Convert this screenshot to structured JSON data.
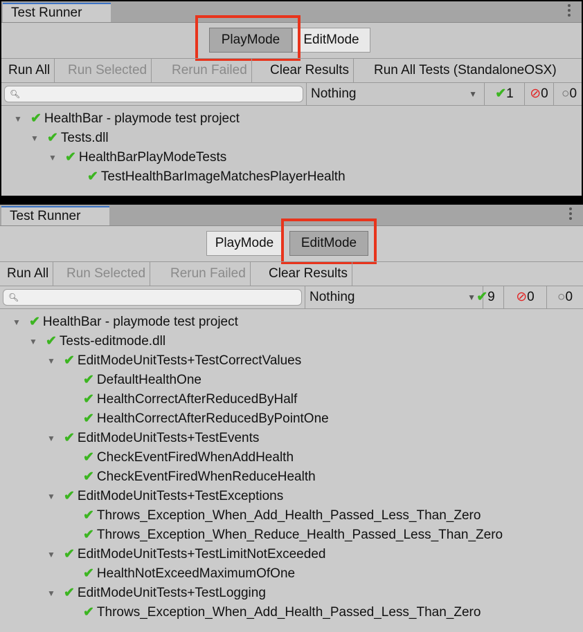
{
  "top": {
    "tab_title": "Test Runner",
    "mode_buttons": {
      "playmode": "PlayMode",
      "editmode": "EditMode",
      "selected": "PlayMode"
    },
    "toolbar": {
      "run_all": "Run All",
      "run_selected": "Run Selected",
      "rerun_failed": "Rerun Failed",
      "clear_results": "Clear Results",
      "run_all_tests_platform": "Run All Tests (StandaloneOSX)"
    },
    "filter": {
      "search_value": "",
      "category": "Nothing",
      "passed": "1",
      "failed": "0",
      "not_run": "0"
    },
    "tree": [
      {
        "label": "HealthBar - playmode test project"
      },
      {
        "label": "Tests.dll"
      },
      {
        "label": "HealthBarPlayModeTests"
      },
      {
        "label": "TestHealthBarImageMatchesPlayerHealth"
      }
    ]
  },
  "bottom": {
    "tab_title": "Test Runner",
    "mode_buttons": {
      "playmode": "PlayMode",
      "editmode": "EditMode",
      "selected": "EditMode"
    },
    "toolbar": {
      "run_all": "Run All",
      "run_selected": "Run Selected",
      "rerun_failed": "Rerun Failed",
      "clear_results": "Clear Results"
    },
    "filter": {
      "search_value": "",
      "category": "Nothing",
      "passed": "9",
      "failed": "0",
      "not_run": "0"
    },
    "tree": [
      {
        "label": "HealthBar - playmode test project"
      },
      {
        "label": "Tests-editmode.dll"
      },
      {
        "label": "EditModeUnitTests+TestCorrectValues"
      },
      {
        "label": "DefaultHealthOne"
      },
      {
        "label": "HealthCorrectAfterReducedByHalf"
      },
      {
        "label": "HealthCorrectAfterReducedByPointOne"
      },
      {
        "label": "EditModeUnitTests+TestEvents"
      },
      {
        "label": "CheckEventFiredWhenAddHealth"
      },
      {
        "label": "CheckEventFiredWhenReduceHealth"
      },
      {
        "label": "EditModeUnitTests+TestExceptions"
      },
      {
        "label": "Throws_Exception_When_Add_Health_Passed_Less_Than_Zero"
      },
      {
        "label": "Throws_Exception_When_Reduce_Health_Passed_Less_Than_Zero"
      },
      {
        "label": "EditModeUnitTests+TestLimitNotExceeded"
      },
      {
        "label": "HealthNotExceedMaximumOfOne"
      },
      {
        "label": "EditModeUnitTests+TestLogging"
      },
      {
        "label": "Throws_Exception_When_Add_Health_Passed_Less_Than_Zero"
      }
    ]
  },
  "icons": {
    "pass": "check-icon",
    "fail": "failed-icon",
    "not_run": "not-run-icon",
    "expand": "triangle-down-icon",
    "search": "search-icon",
    "menu": "kebab-menu-icon"
  },
  "colors": {
    "pass_green": "#3cb521",
    "fail_red": "#e22323",
    "highlight_red": "#e8341c",
    "tab_accent": "#3a72c4"
  }
}
